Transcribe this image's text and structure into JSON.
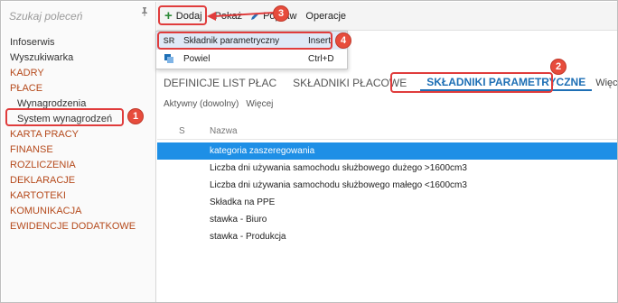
{
  "sidebar": {
    "search_placeholder": "Szukaj poleceń",
    "items": [
      {
        "label": "Infoserwis",
        "kind": "plain"
      },
      {
        "label": "Wyszukiwarka",
        "kind": "plain"
      },
      {
        "label": "KADRY",
        "kind": "section"
      },
      {
        "label": "PŁACE",
        "kind": "section"
      },
      {
        "label": "Wynagrodzenia",
        "kind": "sub"
      },
      {
        "label": "System wynagrodzeń",
        "kind": "sub"
      },
      {
        "label": "KARTA PRACY",
        "kind": "section"
      },
      {
        "label": "FINANSE",
        "kind": "section"
      },
      {
        "label": "ROZLICZENIA",
        "kind": "section"
      },
      {
        "label": "DEKLARACJE",
        "kind": "section"
      },
      {
        "label": "KARTOTEKI",
        "kind": "section"
      },
      {
        "label": "KOMUNIKACJA",
        "kind": "section"
      },
      {
        "label": "EWIDENCJE DODATKOWE",
        "kind": "section"
      }
    ]
  },
  "toolbar": {
    "add_label": "Dodaj",
    "pokaz_label": "Pokaż",
    "popraw_label": "Popraw",
    "operacje_label": "Operacje"
  },
  "dropdown": {
    "items": [
      {
        "icon_text": "SR",
        "label": "Składnik parametryczny",
        "shortcut": "Insert"
      },
      {
        "icon": "duplicate-icon",
        "label": "Powiel",
        "shortcut": "Ctrl+D"
      }
    ]
  },
  "tabs": {
    "items": [
      "DEFINICJE LIST PŁAC",
      "SKŁADNIKI PŁACOWE",
      "SKŁADNIKI PARAMETRYCZNE"
    ],
    "active_index": 2,
    "more_label": "Więcej"
  },
  "filters": {
    "status_label": "Aktywny (dowolny)",
    "more_label": "Więcej"
  },
  "grid": {
    "columns": {
      "s": "S",
      "name": "Nazwa"
    },
    "rows": [
      "kategoria zaszeregowania",
      "Liczba dni używania samochodu służbowego dużego >1600cm3",
      "Liczba dni używania samochodu służbowego małego <1600cm3",
      "Składka na PPE",
      "stawka - Biuro",
      "stawka - Produkcja"
    ],
    "selected_index": 0
  },
  "annotations": {
    "badges": [
      "1",
      "2",
      "3",
      "4"
    ],
    "color": "#e74c3c"
  },
  "colors": {
    "section": "#b54a1c",
    "accent": "#1e6fb5",
    "selection": "#1e8fe6"
  }
}
